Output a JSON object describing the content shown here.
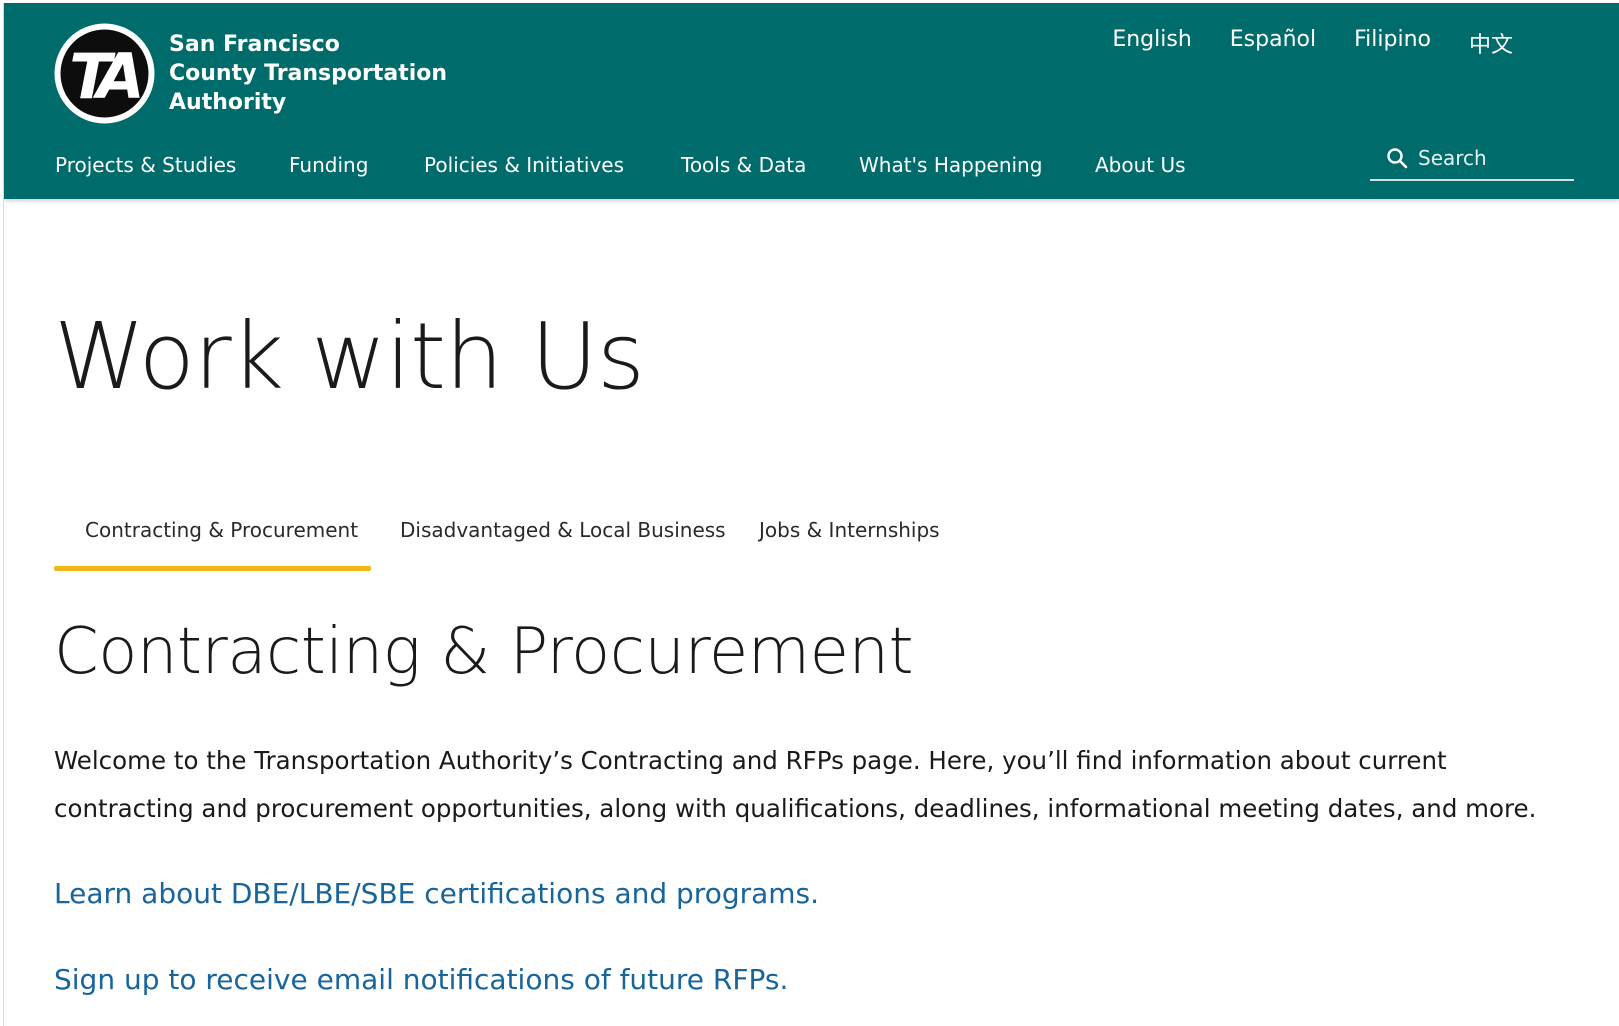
{
  "header": {
    "org_name": {
      "line1": "San Francisco",
      "line2": "County Transportation",
      "line3": "Authority"
    },
    "logo": {
      "icon": "ta-logo-icon",
      "text": "TA"
    },
    "languages": [
      "English",
      "Español",
      "Filipino",
      "中文"
    ],
    "nav": [
      "Projects & Studies",
      "Funding",
      "Policies & Initiatives",
      "Tools & Data",
      "What's Happening",
      "About Us"
    ],
    "search": {
      "icon": "search-icon",
      "placeholder": "Search"
    }
  },
  "main": {
    "page_title": "Work with Us",
    "tabs": [
      {
        "label": "Contracting & Procurement",
        "active": true
      },
      {
        "label": "Disadvantaged & Local Business",
        "active": false
      },
      {
        "label": "Jobs & Internships",
        "active": false
      }
    ],
    "section_title": "Contracting & Procurement",
    "intro": "Welcome to the Transportation Authority’s Contracting and RFPs page. Here, you’ll find information about current contracting and procurement opportunities, along with qualifications, deadlines, informational meeting dates, and more.",
    "links": [
      "Learn about DBE/LBE/SBE certifications and programs.",
      "Sign up to receive email notifications of future RFPs."
    ]
  },
  "colors": {
    "header_bg": "#006b6b",
    "active_tab_underline": "#f2b617",
    "link": "#18659c"
  }
}
